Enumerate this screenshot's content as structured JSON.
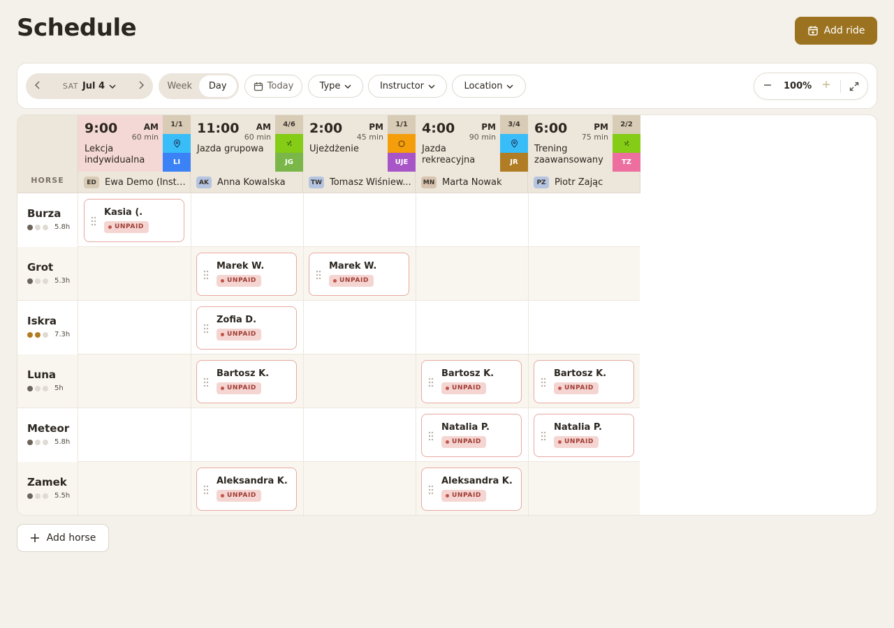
{
  "page": {
    "title": "Schedule",
    "add_ride_label": "Add ride",
    "add_horse_label": "Add horse"
  },
  "toolbar": {
    "day_of_week": "SAT",
    "date": "Jul 4",
    "views": [
      "Week",
      "Day"
    ],
    "active_view": "Day",
    "today_label": "Today",
    "filters": {
      "type": "Type",
      "instructor": "Instructor",
      "location": "Location"
    },
    "zoom": "100%"
  },
  "grid": {
    "horse_header": "HORSE"
  },
  "lessons": [
    {
      "time": "9:00",
      "ampm": "AM",
      "duration": "60 min",
      "name": "Lekcja indywidualna",
      "capacity": "1/1",
      "level_icon": "pin-icon",
      "level_color": "#38bdf8",
      "code": "LI",
      "code_color": "#3b82f6",
      "instructor_initials": "ED",
      "instructor_avatar_color": "#d8ccb6",
      "instructor": "Ewa Demo (Instr..."
    },
    {
      "time": "11:00",
      "ampm": "AM",
      "duration": "60 min",
      "name": "Jazda grupowa",
      "capacity": "4/6",
      "level_icon": "sparkle-icon",
      "level_color": "#84cc16",
      "code": "JG",
      "code_color": "#7ab648",
      "instructor_initials": "AK",
      "instructor_avatar_color": "#b5c4e0",
      "instructor": "Anna Kowalska"
    },
    {
      "time": "2:00",
      "ampm": "PM",
      "duration": "45 min",
      "name": "Ujeżdżenie",
      "capacity": "1/1",
      "level_icon": "circle-icon",
      "level_color": "#f59e0b",
      "code": "UJE",
      "code_color": "#a855c7",
      "instructor_initials": "TW",
      "instructor_avatar_color": "#b5c4e0",
      "instructor": "Tomasz Wiśniew..."
    },
    {
      "time": "4:00",
      "ampm": "PM",
      "duration": "90 min",
      "name": "Jazda rekreacyjna",
      "capacity": "3/4",
      "level_icon": "pin-icon",
      "level_color": "#38bdf8",
      "code": "JR",
      "code_color": "#b07d24",
      "instructor_initials": "MN",
      "instructor_avatar_color": "#d8c3b0",
      "instructor": "Marta Nowak"
    },
    {
      "time": "6:00",
      "ampm": "PM",
      "duration": "75 min",
      "name": "Trening zaawansowany",
      "capacity": "2/2",
      "level_icon": "sparkle-icon",
      "level_color": "#84cc16",
      "code": "TZ",
      "code_color": "#ec6fa0",
      "instructor_initials": "PZ",
      "instructor_avatar_color": "#b5c4e0",
      "instructor": "Piotr Zając"
    }
  ],
  "horses": [
    {
      "name": "Burza",
      "level": 1,
      "hours": "5.8h",
      "bookings": [
        {
          "col": 0,
          "rider": "Kasia (.",
          "status": "UNPAID"
        }
      ]
    },
    {
      "name": "Grot",
      "level": 1,
      "hours": "5.3h",
      "bookings": [
        {
          "col": 1,
          "rider": "Marek W.",
          "status": "UNPAID"
        },
        {
          "col": 2,
          "rider": "Marek W.",
          "status": "UNPAID"
        }
      ]
    },
    {
      "name": "Iskra",
      "level": 2,
      "hours": "7.3h",
      "bookings": [
        {
          "col": 1,
          "rider": "Zofia D.",
          "status": "UNPAID"
        }
      ]
    },
    {
      "name": "Luna",
      "level": 1,
      "hours": "5h",
      "bookings": [
        {
          "col": 1,
          "rider": "Bartosz K.",
          "status": "UNPAID"
        },
        {
          "col": 3,
          "rider": "Bartosz K.",
          "status": "UNPAID"
        },
        {
          "col": 4,
          "rider": "Bartosz K.",
          "status": "UNPAID"
        }
      ]
    },
    {
      "name": "Meteor",
      "level": 1,
      "hours": "5.8h",
      "bookings": [
        {
          "col": 3,
          "rider": "Natalia P.",
          "status": "UNPAID"
        },
        {
          "col": 4,
          "rider": "Natalia P.",
          "status": "UNPAID"
        }
      ]
    },
    {
      "name": "Zamek",
      "level": 1,
      "hours": "5.5h",
      "bookings": [
        {
          "col": 1,
          "rider": "Aleksandra K.",
          "status": "UNPAID"
        },
        {
          "col": 3,
          "rider": "Aleksandra K.",
          "status": "UNPAID"
        }
      ]
    }
  ]
}
